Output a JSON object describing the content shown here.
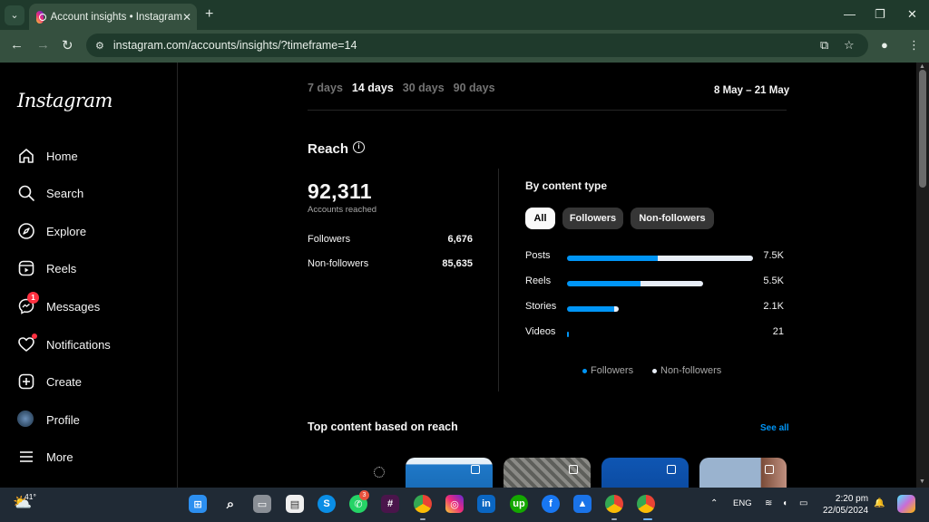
{
  "browser": {
    "tab_title": "Account insights • Instagram",
    "url": "instagram.com/accounts/insights/?timeframe=14"
  },
  "sidebar": {
    "logo": "Instagram",
    "items": [
      {
        "label": "Home",
        "icon": "home-icon"
      },
      {
        "label": "Search",
        "icon": "search-icon"
      },
      {
        "label": "Explore",
        "icon": "compass-icon"
      },
      {
        "label": "Reels",
        "icon": "reels-icon"
      },
      {
        "label": "Messages",
        "icon": "messenger-icon",
        "badge": "1"
      },
      {
        "label": "Notifications",
        "icon": "heart-icon"
      },
      {
        "label": "Create",
        "icon": "plus-square-icon"
      },
      {
        "label": "Profile",
        "icon": "avatar"
      },
      {
        "label": "More",
        "icon": "hamburger-icon"
      }
    ]
  },
  "timeframes": {
    "options": [
      "7 days",
      "14 days",
      "30 days",
      "90 days"
    ],
    "active": "14 days",
    "date_range": "8 May – 21 May"
  },
  "reach": {
    "title": "Reach",
    "total": "92,311",
    "total_caption": "Accounts reached",
    "rows": [
      {
        "label": "Followers",
        "value": "6,676"
      },
      {
        "label": "Non-followers",
        "value": "85,635"
      }
    ]
  },
  "by_content": {
    "title": "By content type",
    "chips": [
      "All",
      "Followers",
      "Non-followers"
    ],
    "active_chip": "All",
    "bars": [
      {
        "label": "Posts",
        "value": "7.5K",
        "total": 7500,
        "followers_share": 0.49
      },
      {
        "label": "Reels",
        "value": "5.5K",
        "total": 5500,
        "followers_share": 0.54
      },
      {
        "label": "Stories",
        "value": "2.1K",
        "total": 2100,
        "followers_share": 0.9
      },
      {
        "label": "Videos",
        "value": "21",
        "total": 21,
        "followers_share": 1.0
      }
    ],
    "legend": [
      "Followers",
      "Non-followers"
    ],
    "colors": {
      "followers": "#0095f6",
      "non_followers": "#e8eef7"
    }
  },
  "top_content": {
    "title": "Top content based on reach",
    "see_all": "See all"
  },
  "taskbar": {
    "temperature": "41°",
    "whatsapp_badge": "3",
    "language": "ENG",
    "time": "2:20 pm",
    "date": "22/05/2024"
  }
}
